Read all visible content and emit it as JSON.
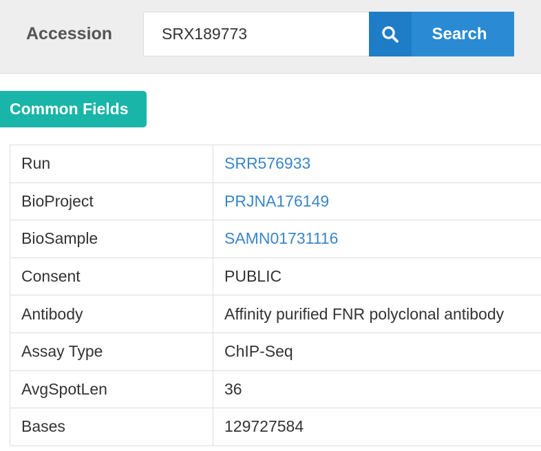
{
  "header": {
    "accession_label": "Accession",
    "search_value": "SRX189773",
    "search_button_label": "Search"
  },
  "section": {
    "title": "Common Fields"
  },
  "fields": [
    {
      "key": "Run",
      "value": "SRR576933",
      "link": true
    },
    {
      "key": "BioProject",
      "value": "PRJNA176149",
      "link": true
    },
    {
      "key": "BioSample",
      "value": "SAMN01731116",
      "link": true
    },
    {
      "key": "Consent",
      "value": "PUBLIC",
      "link": false
    },
    {
      "key": "Antibody",
      "value": "Affinity purified FNR polyclonal antibody",
      "link": false
    },
    {
      "key": "Assay Type",
      "value": "ChIP-Seq",
      "link": false
    },
    {
      "key": "AvgSpotLen",
      "value": "36",
      "link": false
    },
    {
      "key": "Bases",
      "value": "129727584",
      "link": false
    }
  ],
  "colors": {
    "search_button": "#2a8ad4",
    "section_button": "#19b5a8",
    "link": "#3a86c8"
  }
}
